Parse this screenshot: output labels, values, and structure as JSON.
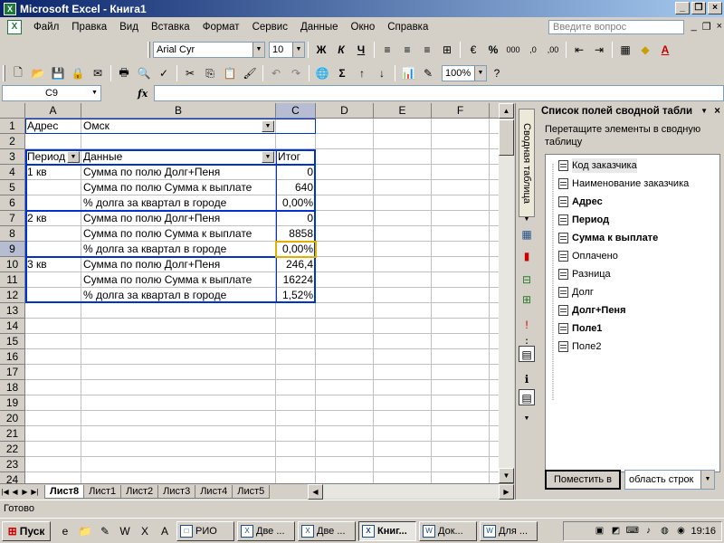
{
  "window": {
    "title": "Microsoft Excel - Книга1",
    "app_icon": "X"
  },
  "menu": {
    "items": [
      "Файл",
      "Правка",
      "Вид",
      "Вставка",
      "Формат",
      "Сервис",
      "Данные",
      "Окно",
      "Справка"
    ],
    "help_placeholder": "Введите вопрос"
  },
  "format_toolbar": {
    "font": "Arial Cyr",
    "size": "10",
    "bold": "Ж",
    "italic": "К",
    "underline": "Ч",
    "percent": "%",
    "thousands": "000",
    "font_color_letter": "A"
  },
  "standard_toolbar": {
    "zoom": "100%"
  },
  "formula": {
    "name_box": "C9",
    "fx": "fx",
    "value": ""
  },
  "columns": [
    {
      "label": "A",
      "width": 62
    },
    {
      "label": "B",
      "width": 215
    },
    {
      "label": "C",
      "width": 44
    },
    {
      "label": "D",
      "width": 64
    },
    {
      "label": "E",
      "width": 64
    },
    {
      "label": "F",
      "width": 64
    }
  ],
  "rows": [
    "1",
    "2",
    "3",
    "4",
    "5",
    "6",
    "7",
    "8",
    "9",
    "10",
    "11",
    "12",
    "13",
    "14",
    "15",
    "16",
    "17",
    "18",
    "19",
    "20",
    "21",
    "22",
    "23",
    "24"
  ],
  "cells": {
    "A1": "Адрес",
    "B1": "Омск",
    "A3": "Период",
    "B3": "Данные",
    "C3": "Итог",
    "A4": "1 кв",
    "B4": "Сумма по полю Долг+Пеня",
    "C4": "0",
    "B5": "Сумма по полю Сумма к выплате",
    "C5": "640",
    "B6": "% долга за квартал в городе",
    "C6": "0,00%",
    "A7": "2 кв",
    "B7": "Сумма по полю Долг+Пеня",
    "C7": "0",
    "B8": "Сумма по полю Сумма к выплате",
    "C8": "8858",
    "B9": "% долга за квартал в городе",
    "C9": "0,00%",
    "A10": "3 кв",
    "B10": "Сумма по полю Долг+Пеня",
    "C10": "246,4",
    "B11": "Сумма по полю Сумма к выплате",
    "C11": "16224",
    "B12": "% долга за квартал в городе",
    "C12": "1,52%"
  },
  "sheet_tabs": [
    "Лист8",
    "Лист1",
    "Лист2",
    "Лист3",
    "Лист4",
    "Лист5"
  ],
  "active_sheet": "Лист8",
  "status": "Готово",
  "sidebar_tab": "Сводная таблица",
  "field_list": {
    "title": "Список полей сводной табли",
    "description": "Перетащите элементы в сводную таблицу",
    "fields": [
      {
        "label": "Код заказчика",
        "bold": false
      },
      {
        "label": "Наименование заказчика",
        "bold": false
      },
      {
        "label": "Адрес",
        "bold": true
      },
      {
        "label": "Период",
        "bold": true
      },
      {
        "label": "Сумма к выплате",
        "bold": true
      },
      {
        "label": "Оплачено",
        "bold": false
      },
      {
        "label": "Разница",
        "bold": false
      },
      {
        "label": "Долг",
        "bold": false
      },
      {
        "label": "Долг+Пеня",
        "bold": true
      },
      {
        "label": "Поле1",
        "bold": true
      },
      {
        "label": "Поле2",
        "bold": false
      }
    ],
    "place_button": "Поместить в",
    "area": "область строк"
  },
  "taskbar": {
    "start": "Пуск",
    "buttons": [
      {
        "label": "РИО",
        "active": false
      },
      {
        "label": "Две ...",
        "active": false
      },
      {
        "label": "Две ...",
        "active": false
      },
      {
        "label": "Книг...",
        "active": true
      },
      {
        "label": "Док...",
        "active": false
      },
      {
        "label": "Для ...",
        "active": false
      }
    ],
    "clock": "19:16"
  },
  "colors": {
    "title_start": "#0a246a",
    "title_end": "#a6caf0",
    "pivot_border": "#0033cc",
    "selection": "#e0b000"
  }
}
